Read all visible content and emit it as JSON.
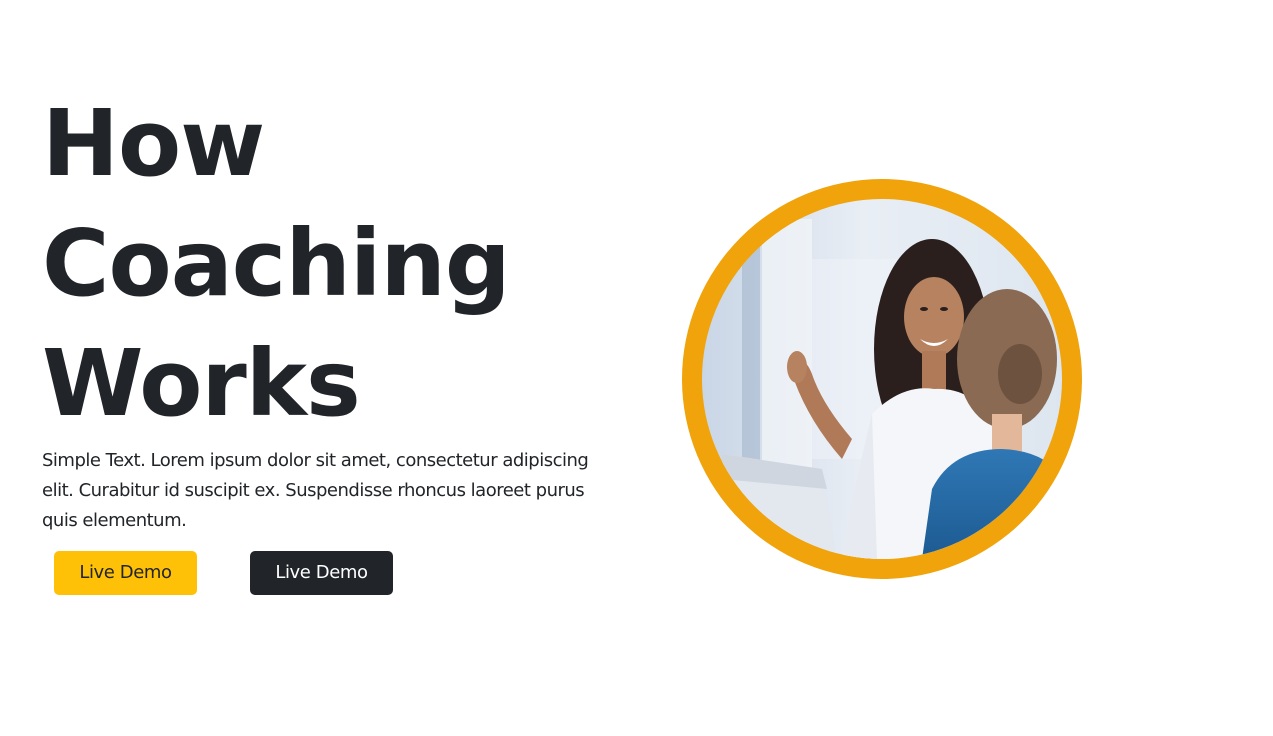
{
  "hero": {
    "heading_lines": [
      "How",
      "Coaching",
      "Works"
    ],
    "description": "Simple Text. Lorem ipsum dolor sit amet, consectetur adipiscing elit. Curabitur id suscipit ex. Suspendisse rhoncus laoreet purus quis elementum.",
    "primary_button": "Live Demo",
    "secondary_button": "Live Demo",
    "image_icon": "coaching-photo",
    "colors": {
      "accent": "#ffc107",
      "ring": "#f0a30a",
      "dark": "#212529",
      "text": "#212529"
    }
  }
}
